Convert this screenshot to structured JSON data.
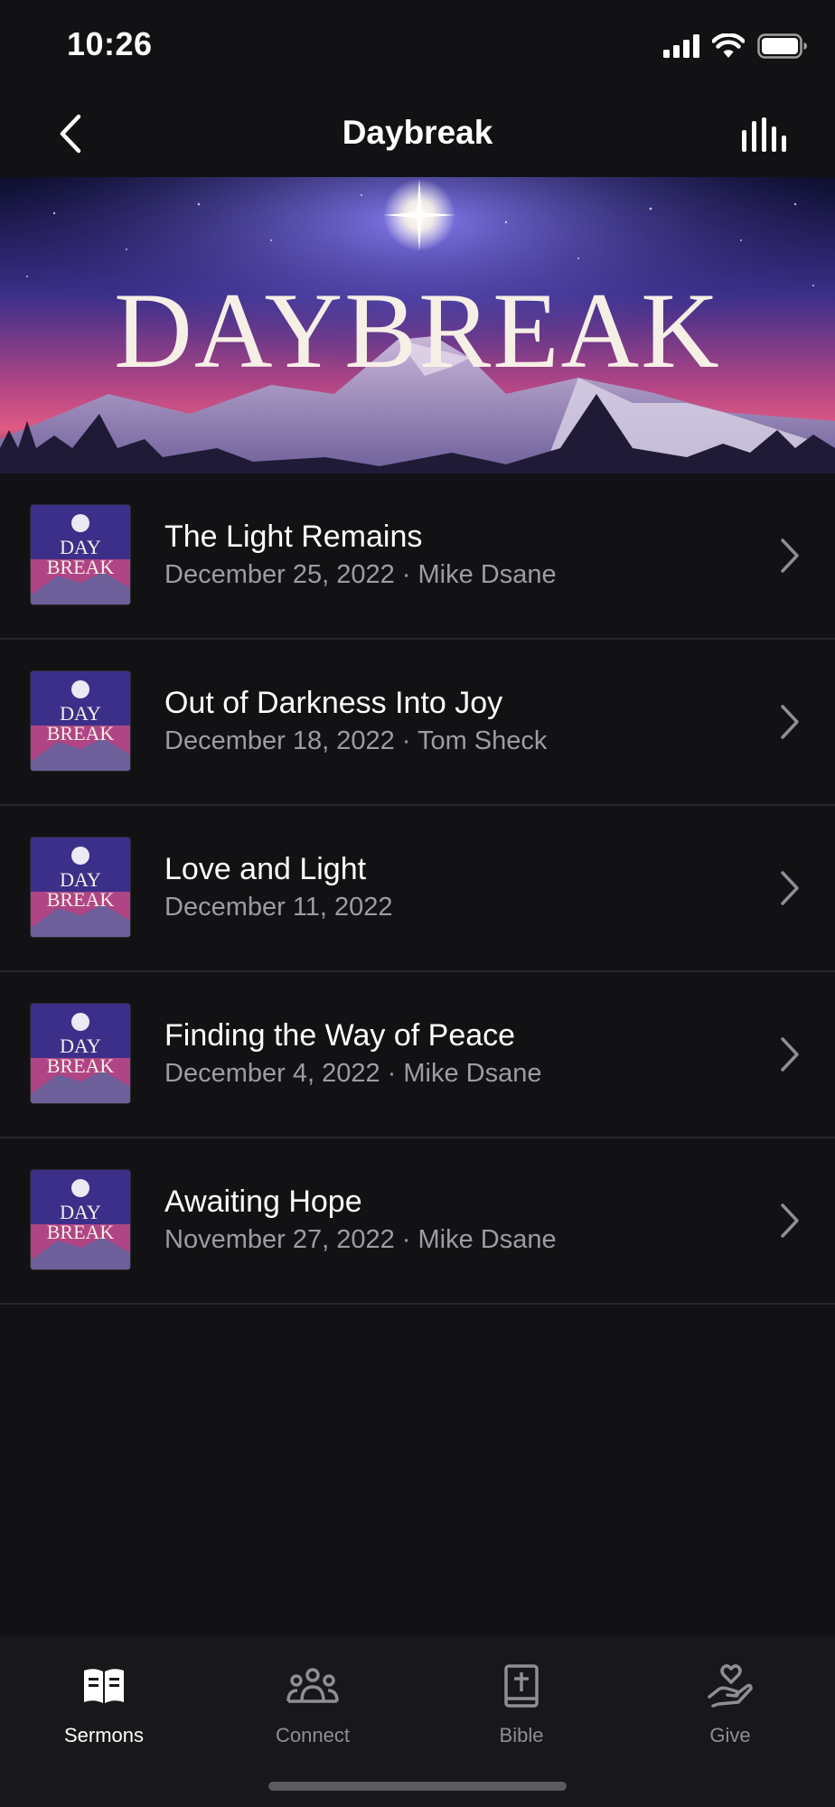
{
  "status_bar": {
    "time": "10:26"
  },
  "nav": {
    "title": "Daybreak"
  },
  "banner": {
    "title": "DAYBREAK"
  },
  "thumbnail_text": {
    "line1": "DAY",
    "line2": "BREAK"
  },
  "sermons": [
    {
      "title": "The Light Remains",
      "subtitle": "December 25, 2022 · Mike Dsane"
    },
    {
      "title": "Out of Darkness Into Joy",
      "subtitle": "December 18, 2022 · Tom Sheck"
    },
    {
      "title": "Love and Light",
      "subtitle": "December 11, 2022"
    },
    {
      "title": "Finding the Way of Peace",
      "subtitle": "December 4, 2022 · Mike Dsane"
    },
    {
      "title": "Awaiting Hope",
      "subtitle": "November 27, 2022 · Mike Dsane"
    }
  ],
  "tabs": [
    {
      "label": "Sermons",
      "icon": "open-book-icon",
      "active": true
    },
    {
      "label": "Connect",
      "icon": "people-group-icon",
      "active": false
    },
    {
      "label": "Bible",
      "icon": "bible-icon",
      "active": false
    },
    {
      "label": "Give",
      "icon": "give-heart-hand-icon",
      "active": false
    }
  ],
  "colors": {
    "background": "#121214",
    "tab_bar": "#18181b",
    "subtitle_text": "#9c9ca2",
    "inactive_tab": "#8e8e93",
    "separator": "#25262a"
  }
}
